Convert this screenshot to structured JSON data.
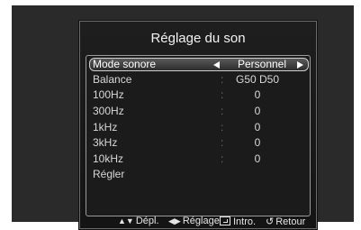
{
  "menu": {
    "title": "Réglage du son",
    "rows": [
      {
        "label": "Mode sonore",
        "colon": "",
        "value": "Personnel"
      },
      {
        "label": "Balance",
        "colon": ":",
        "value": "G50 D50"
      },
      {
        "label": "100Hz",
        "colon": ":",
        "value": "0"
      },
      {
        "label": "300Hz",
        "colon": ":",
        "value": "0"
      },
      {
        "label": "1kHz",
        "colon": ":",
        "value": "0"
      },
      {
        "label": "3kHz",
        "colon": ":",
        "value": "0"
      },
      {
        "label": "10kHz",
        "colon": ":",
        "value": "0"
      },
      {
        "label": "Régler",
        "colon": "",
        "value": ""
      }
    ]
  },
  "footer": {
    "move_label": "Dépl.",
    "adjust_label": "Réglage",
    "enter_label": "Intro.",
    "return_label": "Retour"
  },
  "icons": {
    "move": "up-down-arrows-icon",
    "adjust": "left-right-arrows-icon",
    "enter": "enter-icon",
    "return": "return-icon"
  }
}
